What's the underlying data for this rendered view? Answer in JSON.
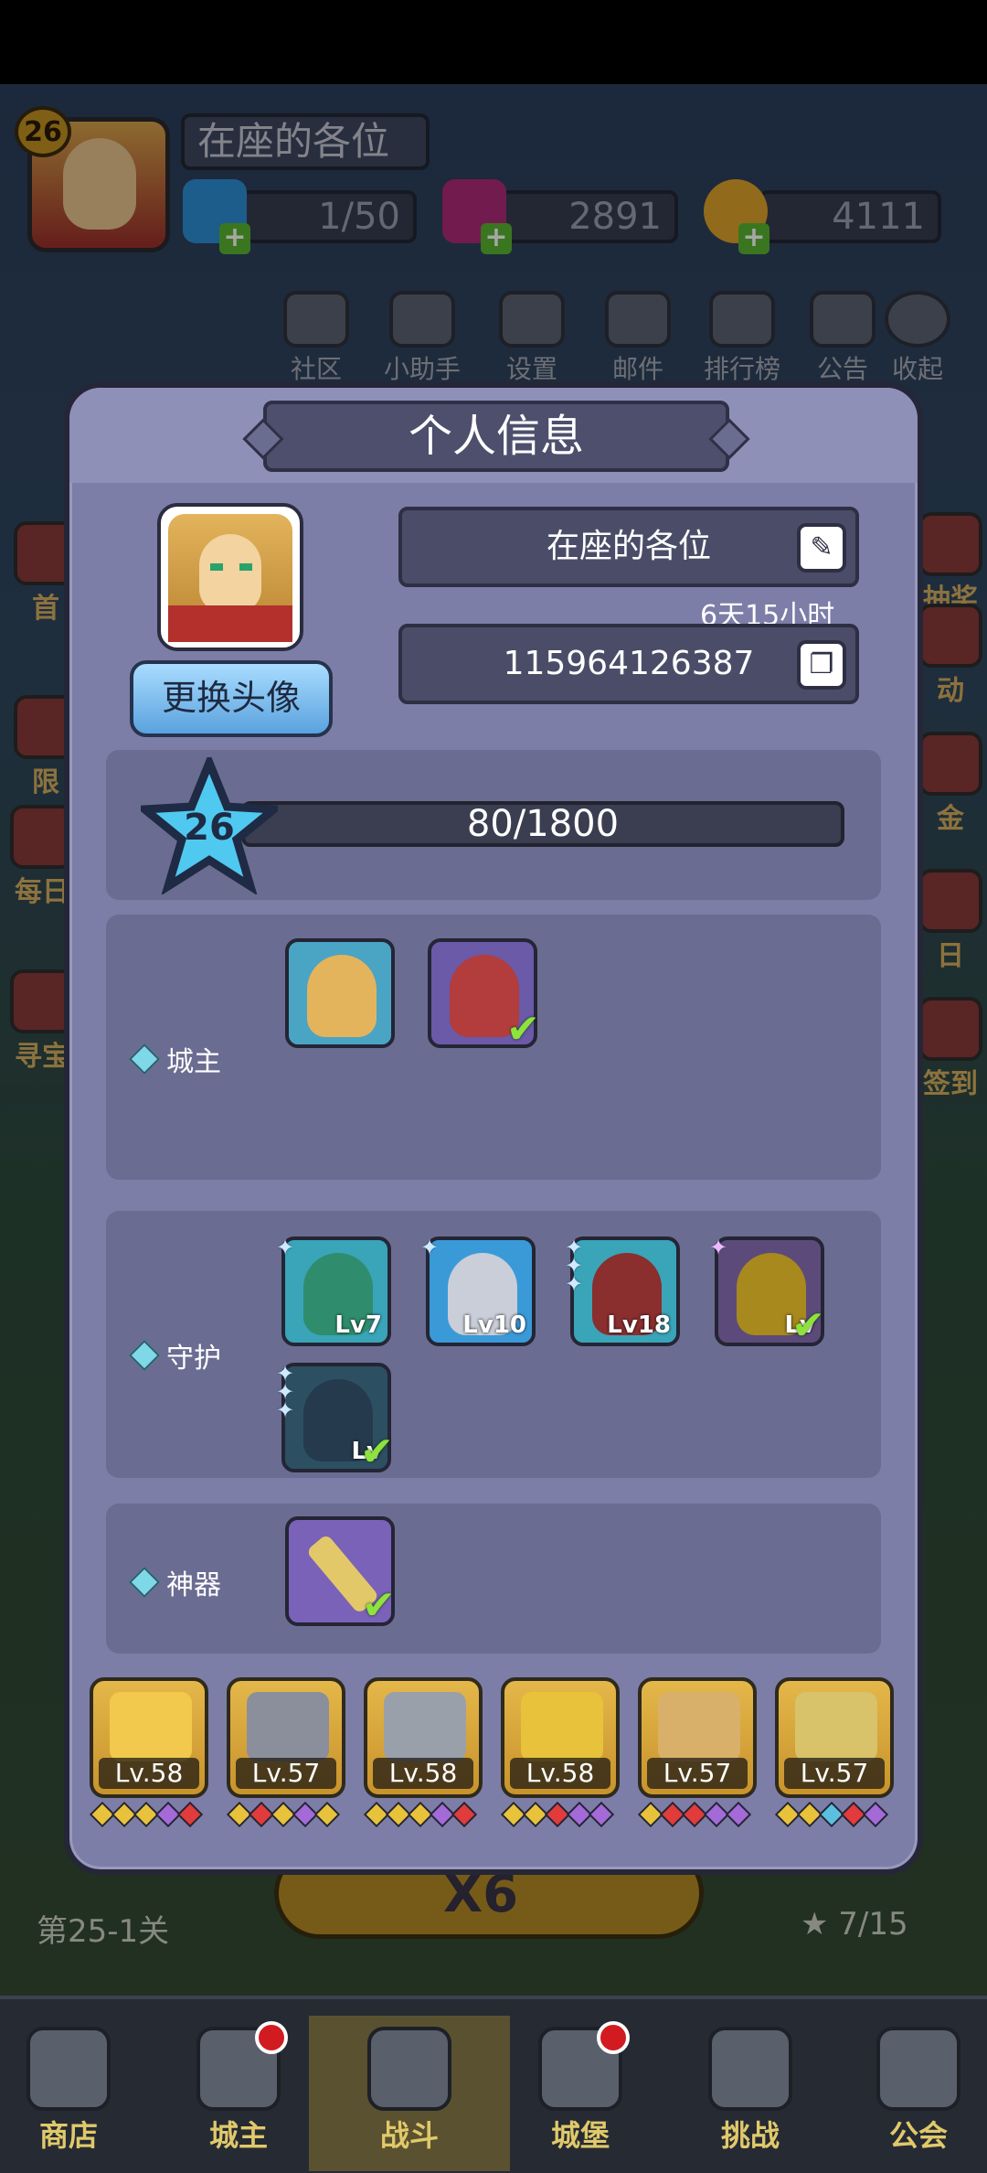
{
  "player": {
    "level": "26",
    "name": "在座的各位",
    "stamina": "1/50",
    "gems": "2891",
    "gold": "4111"
  },
  "top_menu": [
    "社区",
    "小助手",
    "设置",
    "邮件",
    "排行榜",
    "公告",
    "收起"
  ],
  "side_left": [
    "首",
    "限",
    "每日",
    "寻宝"
  ],
  "side_right": [
    "抽奖",
    "动",
    "金",
    "日",
    "签到"
  ],
  "stage": {
    "label": "第25-1关",
    "multiplier": "X6",
    "stars": "7/15"
  },
  "bottom_nav": [
    {
      "label": "商店",
      "badge": false
    },
    {
      "label": "城主",
      "badge": true
    },
    {
      "label": "战斗",
      "badge": false,
      "active": true
    },
    {
      "label": "城堡",
      "badge": true
    },
    {
      "label": "挑战",
      "badge": false
    },
    {
      "label": "公会",
      "badge": false
    }
  ],
  "modal": {
    "title": "个人信息",
    "change_avatar": "更换头像",
    "name": "在座的各位",
    "time_left": "6天15小时",
    "user_id": "115964126387",
    "level": "26",
    "xp": "80/1800",
    "sections": {
      "lords": "城主",
      "guardians": "守护",
      "artifacts": "神器"
    },
    "guardian_tiles": [
      {
        "level": "Lv7"
      },
      {
        "level": "Lv10"
      },
      {
        "level": "Lv18"
      },
      {
        "level": "Lv"
      },
      {
        "level": "Lv"
      }
    ],
    "equipment": [
      {
        "name": "crown",
        "level": "Lv.58",
        "gem_colors": [
          "#e8c23a",
          "#e8c23a",
          "#e8c23a",
          "#a36ad8",
          "#e23b3b"
        ]
      },
      {
        "name": "armor",
        "level": "Lv.57",
        "gem_colors": [
          "#e8c23a",
          "#e23b3b",
          "#e8c23a",
          "#a36ad8",
          "#e8c23a"
        ]
      },
      {
        "name": "boots",
        "level": "Lv.58",
        "gem_colors": [
          "#e8c23a",
          "#e8c23a",
          "#e8c23a",
          "#a36ad8",
          "#e23b3b"
        ]
      },
      {
        "name": "staff",
        "level": "Lv.58",
        "gem_colors": [
          "#e8c23a",
          "#e8c23a",
          "#e23b3b",
          "#a36ad8",
          "#a36ad8"
        ]
      },
      {
        "name": "ring",
        "level": "Lv.57",
        "gem_colors": [
          "#e8c23a",
          "#e23b3b",
          "#e23b3b",
          "#a36ad8",
          "#a36ad8"
        ]
      },
      {
        "name": "bow",
        "level": "Lv.57",
        "gem_colors": [
          "#e8c23a",
          "#e8c23a",
          "#5bc0de",
          "#e23b3b",
          "#a36ad8"
        ]
      }
    ]
  },
  "colors": {
    "modal_bg": "#7c7ea7",
    "panel_bg": "#6b6c91",
    "check_green": "#8ce43a",
    "button_blue": "#5aa2de"
  }
}
